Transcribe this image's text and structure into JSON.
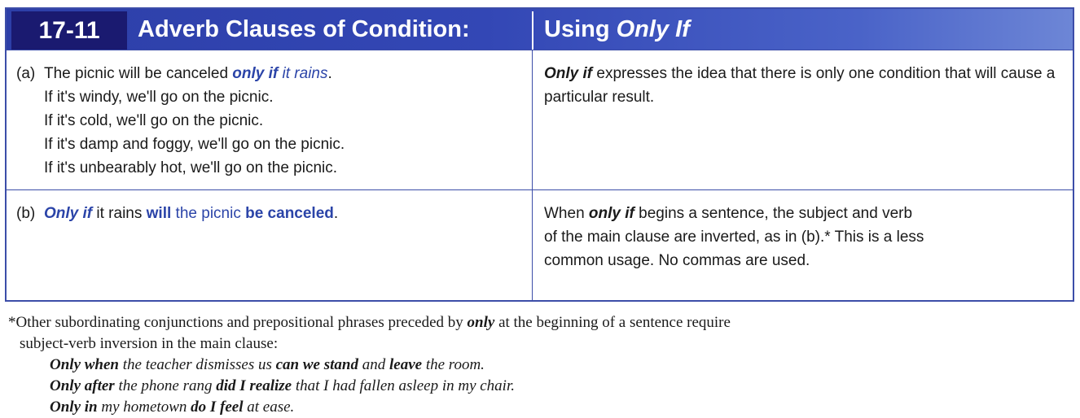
{
  "chart": {
    "number": "17-11",
    "title_main": "Adverb Clauses of Condition:",
    "title_sub_prefix": "Using ",
    "title_sub_italic": "Only If"
  },
  "row_a": {
    "label": "(a)",
    "line1_prefix": "The picnic will be canceled ",
    "line1_keyword": "only if",
    "line1_clause": " it rains",
    "line1_suffix": ".",
    "lines": [
      "If it's windy, we'll go on the picnic.",
      "If it's cold, we'll go on the picnic.",
      "If it's damp and foggy, we'll go on the picnic.",
      "If it's unbearably hot, we'll go on the picnic."
    ],
    "explanation_keyword": "Only if",
    "explanation_rest": " expresses the idea that there is only one condition that will cause a particular result."
  },
  "row_b": {
    "label": "(b)",
    "part1": "Only if",
    "part2": " it rains ",
    "part3": "will",
    "part4": " the picnic ",
    "part5": "be canceled",
    "part6": ".",
    "exp_prefix": "When ",
    "exp_keyword": "only if",
    "exp_line1_rest": " begins a sentence, the subject and verb",
    "exp_line2": "of the main clause are inverted, as in (b).*  This is a less",
    "exp_line3": "common usage.  No commas are used."
  },
  "footnote": {
    "intro_prefix": "*Other subordinating conjunctions and prepositional phrases preceded by ",
    "intro_keyword": "only",
    "intro_suffix": " at the beginning of a sentence require",
    "intro_line2": "subject-verb inversion in the main clause:",
    "ex1": {
      "a": "Only when",
      "b": " the teacher dismisses us ",
      "c": "can we stand",
      "d": " and ",
      "e": "leave",
      "f": " the room."
    },
    "ex2": {
      "a": "Only after",
      "b": " the phone rang ",
      "c": "did I realize",
      "d": " that I had fallen asleep in my chair."
    },
    "ex3": {
      "a": "Only in",
      "b": " my hometown ",
      "c": "do I feel",
      "d": " at ease."
    }
  }
}
